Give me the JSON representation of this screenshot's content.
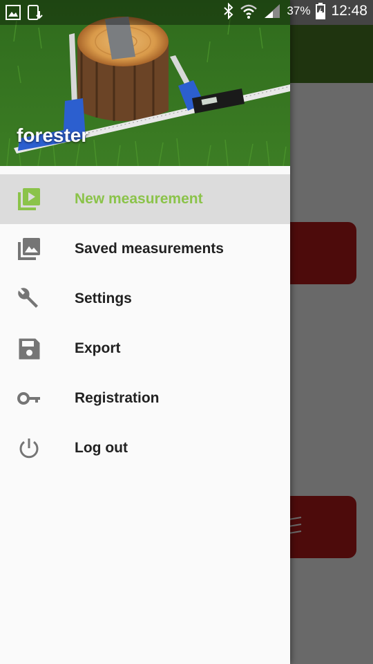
{
  "status_bar": {
    "battery_percent": "37%",
    "time": "12:48",
    "icons": [
      "gallery-icon",
      "download-icon",
      "bluetooth-icon",
      "wifi-icon",
      "signal-icon",
      "battery-icon"
    ]
  },
  "drawer": {
    "header_title": "forester",
    "items": [
      {
        "label": "New measurement",
        "icon": "play-library-icon",
        "active": true
      },
      {
        "label": "Saved measurements",
        "icon": "photo-library-icon",
        "active": false
      },
      {
        "label": "Settings",
        "icon": "wrench-icon",
        "active": false
      },
      {
        "label": "Export",
        "icon": "save-icon",
        "active": false
      },
      {
        "label": "Registration",
        "icon": "key-icon",
        "active": false
      },
      {
        "label": "Log out",
        "icon": "power-icon",
        "active": false
      }
    ]
  },
  "colors": {
    "accent": "#8bc34a",
    "toolbar": "#4a7d25",
    "background_button": "#b71c1c",
    "icon": "#757575"
  }
}
